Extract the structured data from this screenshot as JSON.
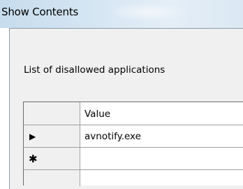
{
  "window": {
    "title": "Show Contents"
  },
  "dialog": {
    "caption": "List of disallowed applications"
  },
  "grid": {
    "column_header": "Value",
    "rows": [
      {
        "indicator": "▶",
        "value": "avnotify.exe"
      },
      {
        "indicator": "✱",
        "value": ""
      }
    ]
  }
}
